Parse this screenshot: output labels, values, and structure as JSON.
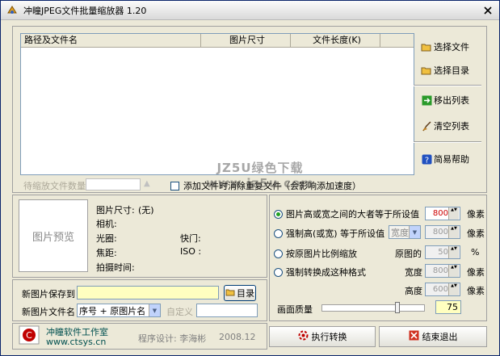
{
  "window": {
    "title": "冲瞳JPEG文件批量缩放器  1.20"
  },
  "file_list": {
    "columns": [
      "路径及文件名",
      "图片尺寸",
      "文件长度(K)"
    ],
    "rows": []
  },
  "side_buttons": {
    "select_files": "选择文件",
    "select_dir": "选择目录",
    "remove_list": "移出列表",
    "clear_list": "清空列表",
    "help": "简易帮助"
  },
  "pending": {
    "label": "待缩放文件数量",
    "value": ""
  },
  "dedupe_option": {
    "label": "添加文件时消除重复文件（会影响添加速度）",
    "checked": false
  },
  "preview": {
    "placeholder": "图片预览",
    "size_label": "图片尺寸:",
    "size_value": "(无)",
    "camera_label": "相机:",
    "aperture_label": "光圈:",
    "shutter_label": "快门:",
    "focal_label": "焦距:",
    "iso_label": "ISO :",
    "shot_time_label": "拍摄时间:"
  },
  "resize_options": {
    "opt1": {
      "label": "图片高或宽之间的大者等于所设值",
      "value": "800",
      "unit": "像素",
      "selected": true
    },
    "opt2": {
      "label": "强制高(或宽) 等于所设值",
      "combo": "宽度",
      "value": "800",
      "unit": "像素",
      "selected": false
    },
    "opt3": {
      "label": "按原图片比例缩放",
      "sub_label": "原图的",
      "value": "50",
      "unit": "%",
      "selected": false
    },
    "opt4": {
      "label": "强制转换成这种格式",
      "width_label": "宽度",
      "width_value": "800",
      "height_label": "高度",
      "height_value": "600",
      "unit": "像素",
      "selected": false
    }
  },
  "quality": {
    "label": "画面质量",
    "value": "75",
    "level_percent": 75
  },
  "output": {
    "save_to_label": "新图片保存到",
    "save_to_value": "",
    "dir_button": "目录",
    "name_label": "新图片文件名",
    "name_combo": "序号 + 原图片名",
    "custom_label": "自定义",
    "custom_value": ""
  },
  "footer": {
    "studio": "冲瞳软件工作室",
    "url": "www.ctsys.cn",
    "designer": "程序设计: 李海彬",
    "date": "2008.12"
  },
  "actions": {
    "convert": "执行转换",
    "exit": "结束退出"
  },
  "watermark": "JZ5U绿色下载 www.jz5u.com",
  "colors": {
    "title_blue": "#0a246a",
    "accent_red": "#c00000",
    "radio_green": "#21a121"
  }
}
